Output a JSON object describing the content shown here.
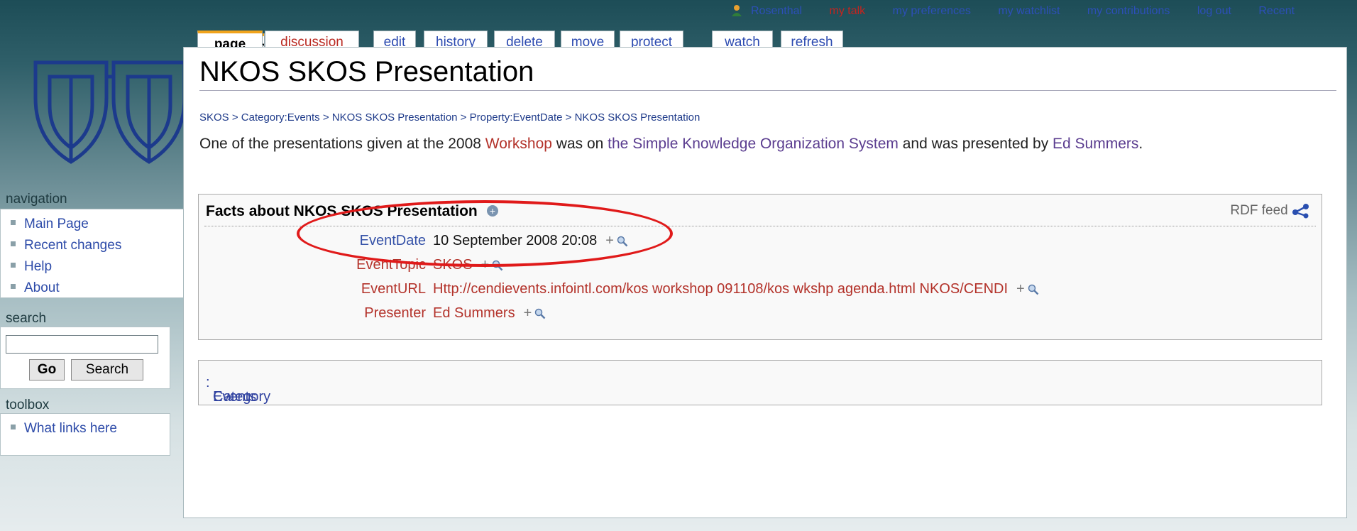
{
  "personal_bar": {
    "items": [
      "Rosenthal",
      "my talk",
      "my preferences",
      "my watchlist",
      "my contributions",
      "log out",
      "Recent"
    ]
  },
  "tabs": [
    {
      "label": "page"
    },
    {
      "label": "discussion"
    },
    {
      "label": "edit"
    },
    {
      "label": "history"
    },
    {
      "label": "delete"
    },
    {
      "label": "move"
    },
    {
      "label": "protect"
    },
    {
      "label": "watch"
    },
    {
      "label": "refresh"
    }
  ],
  "sidebar": {
    "navigation_title": "navigation",
    "navigation_items": [
      "Main Page",
      "Recent changes",
      "Help",
      "About"
    ],
    "search_title": "search",
    "search_value": "",
    "go_label": "Go",
    "search_label": "Search",
    "toolbox_title": "toolbox",
    "toolbox_items": [
      "What links here"
    ]
  },
  "page": {
    "title": "NKOS SKOS Presentation",
    "breadcrumb": "SKOS > Category:Events > NKOS SKOS Presentation > Property:EventDate > NKOS SKOS Presentation",
    "intro_1": "One of the presentations given at the 2008 ",
    "intro_link1": "Workshop",
    "intro_2": " was on ",
    "intro_link2": "the Simple Knowledge Organization System",
    "intro_3": " and was presented by ",
    "intro_link3": "Ed Summers",
    "intro_4": "."
  },
  "facts": {
    "title": "Facts about NKOS SKOS Presentation",
    "rdf_label": "RDF feed",
    "rows": [
      {
        "property": "EventDate",
        "value": "10 September 2008 20:08"
      },
      {
        "property": "EventTopic",
        "value": "SKOS"
      },
      {
        "property": "EventURL",
        "value": "Http://cendievents.infointl.com/kos workshop 091108/kos wkshp agenda.html NKOS/CENDI"
      },
      {
        "property": "Presenter",
        "value": "Ed Summers"
      }
    ],
    "plus": "+"
  },
  "category": {
    "label": "Category",
    "value": "Events"
  },
  "colors": {
    "tab_selected_accent": "#f0a31c",
    "new_link": "#b3322a",
    "annotation_circle": "#e01a1a"
  }
}
